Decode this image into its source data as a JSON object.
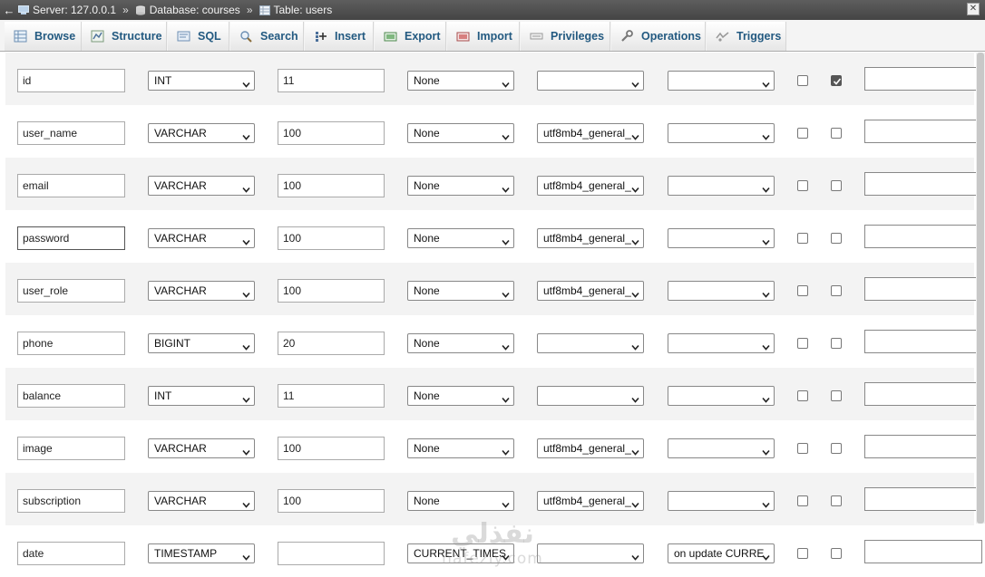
{
  "breadcrumb": {
    "server": "Server: 127.0.0.1",
    "database": "Database: courses",
    "table": "Table: users",
    "separator": "»"
  },
  "tabs": [
    {
      "label": "Browse",
      "icon": "table-icon"
    },
    {
      "label": "Structure",
      "icon": "structure-icon"
    },
    {
      "label": "SQL",
      "icon": "sql-icon"
    },
    {
      "label": "Search",
      "icon": "search-icon"
    },
    {
      "label": "Insert",
      "icon": "insert-icon"
    },
    {
      "label": "Export",
      "icon": "export-icon"
    },
    {
      "label": "Import",
      "icon": "import-icon"
    },
    {
      "label": "Privileges",
      "icon": "privileges-icon"
    },
    {
      "label": "Operations",
      "icon": "wrench-icon"
    },
    {
      "label": "Triggers",
      "icon": "triggers-icon"
    }
  ],
  "columns": [
    {
      "name": "id",
      "type": "INT",
      "length": "11",
      "default": "None",
      "collation": "",
      "attributes": "",
      "null": false,
      "index": true,
      "comment": ""
    },
    {
      "name": "user_name",
      "type": "VARCHAR",
      "length": "100",
      "default": "None",
      "collation": "utf8mb4_general_",
      "attributes": "",
      "null": false,
      "index": false,
      "comment": ""
    },
    {
      "name": "email",
      "type": "VARCHAR",
      "length": "100",
      "default": "None",
      "collation": "utf8mb4_general_",
      "attributes": "",
      "null": false,
      "index": false,
      "comment": ""
    },
    {
      "name": "password",
      "type": "VARCHAR",
      "length": "100",
      "default": "None",
      "collation": "utf8mb4_general_",
      "attributes": "",
      "null": false,
      "index": false,
      "comment": ""
    },
    {
      "name": "user_role",
      "type": "VARCHAR",
      "length": "100",
      "default": "None",
      "collation": "utf8mb4_general_",
      "attributes": "",
      "null": false,
      "index": false,
      "comment": ""
    },
    {
      "name": "phone",
      "type": "BIGINT",
      "length": "20",
      "default": "None",
      "collation": "",
      "attributes": "",
      "null": false,
      "index": false,
      "comment": ""
    },
    {
      "name": "balance",
      "type": "INT",
      "length": "11",
      "default": "None",
      "collation": "",
      "attributes": "",
      "null": false,
      "index": false,
      "comment": ""
    },
    {
      "name": "image",
      "type": "VARCHAR",
      "length": "100",
      "default": "None",
      "collation": "utf8mb4_general_",
      "attributes": "",
      "null": false,
      "index": false,
      "comment": ""
    },
    {
      "name": "subscription",
      "type": "VARCHAR",
      "length": "100",
      "default": "None",
      "collation": "utf8mb4_general_",
      "attributes": "",
      "null": false,
      "index": false,
      "comment": ""
    },
    {
      "name": "date",
      "type": "TIMESTAMP",
      "length": "",
      "default": "CURRENT_TIMES",
      "collation": "",
      "attributes": "on update CURRE",
      "null": false,
      "index": false,
      "comment": ""
    }
  ],
  "watermark": {
    "logo": "نفذلي",
    "text": "nafezly.com"
  }
}
